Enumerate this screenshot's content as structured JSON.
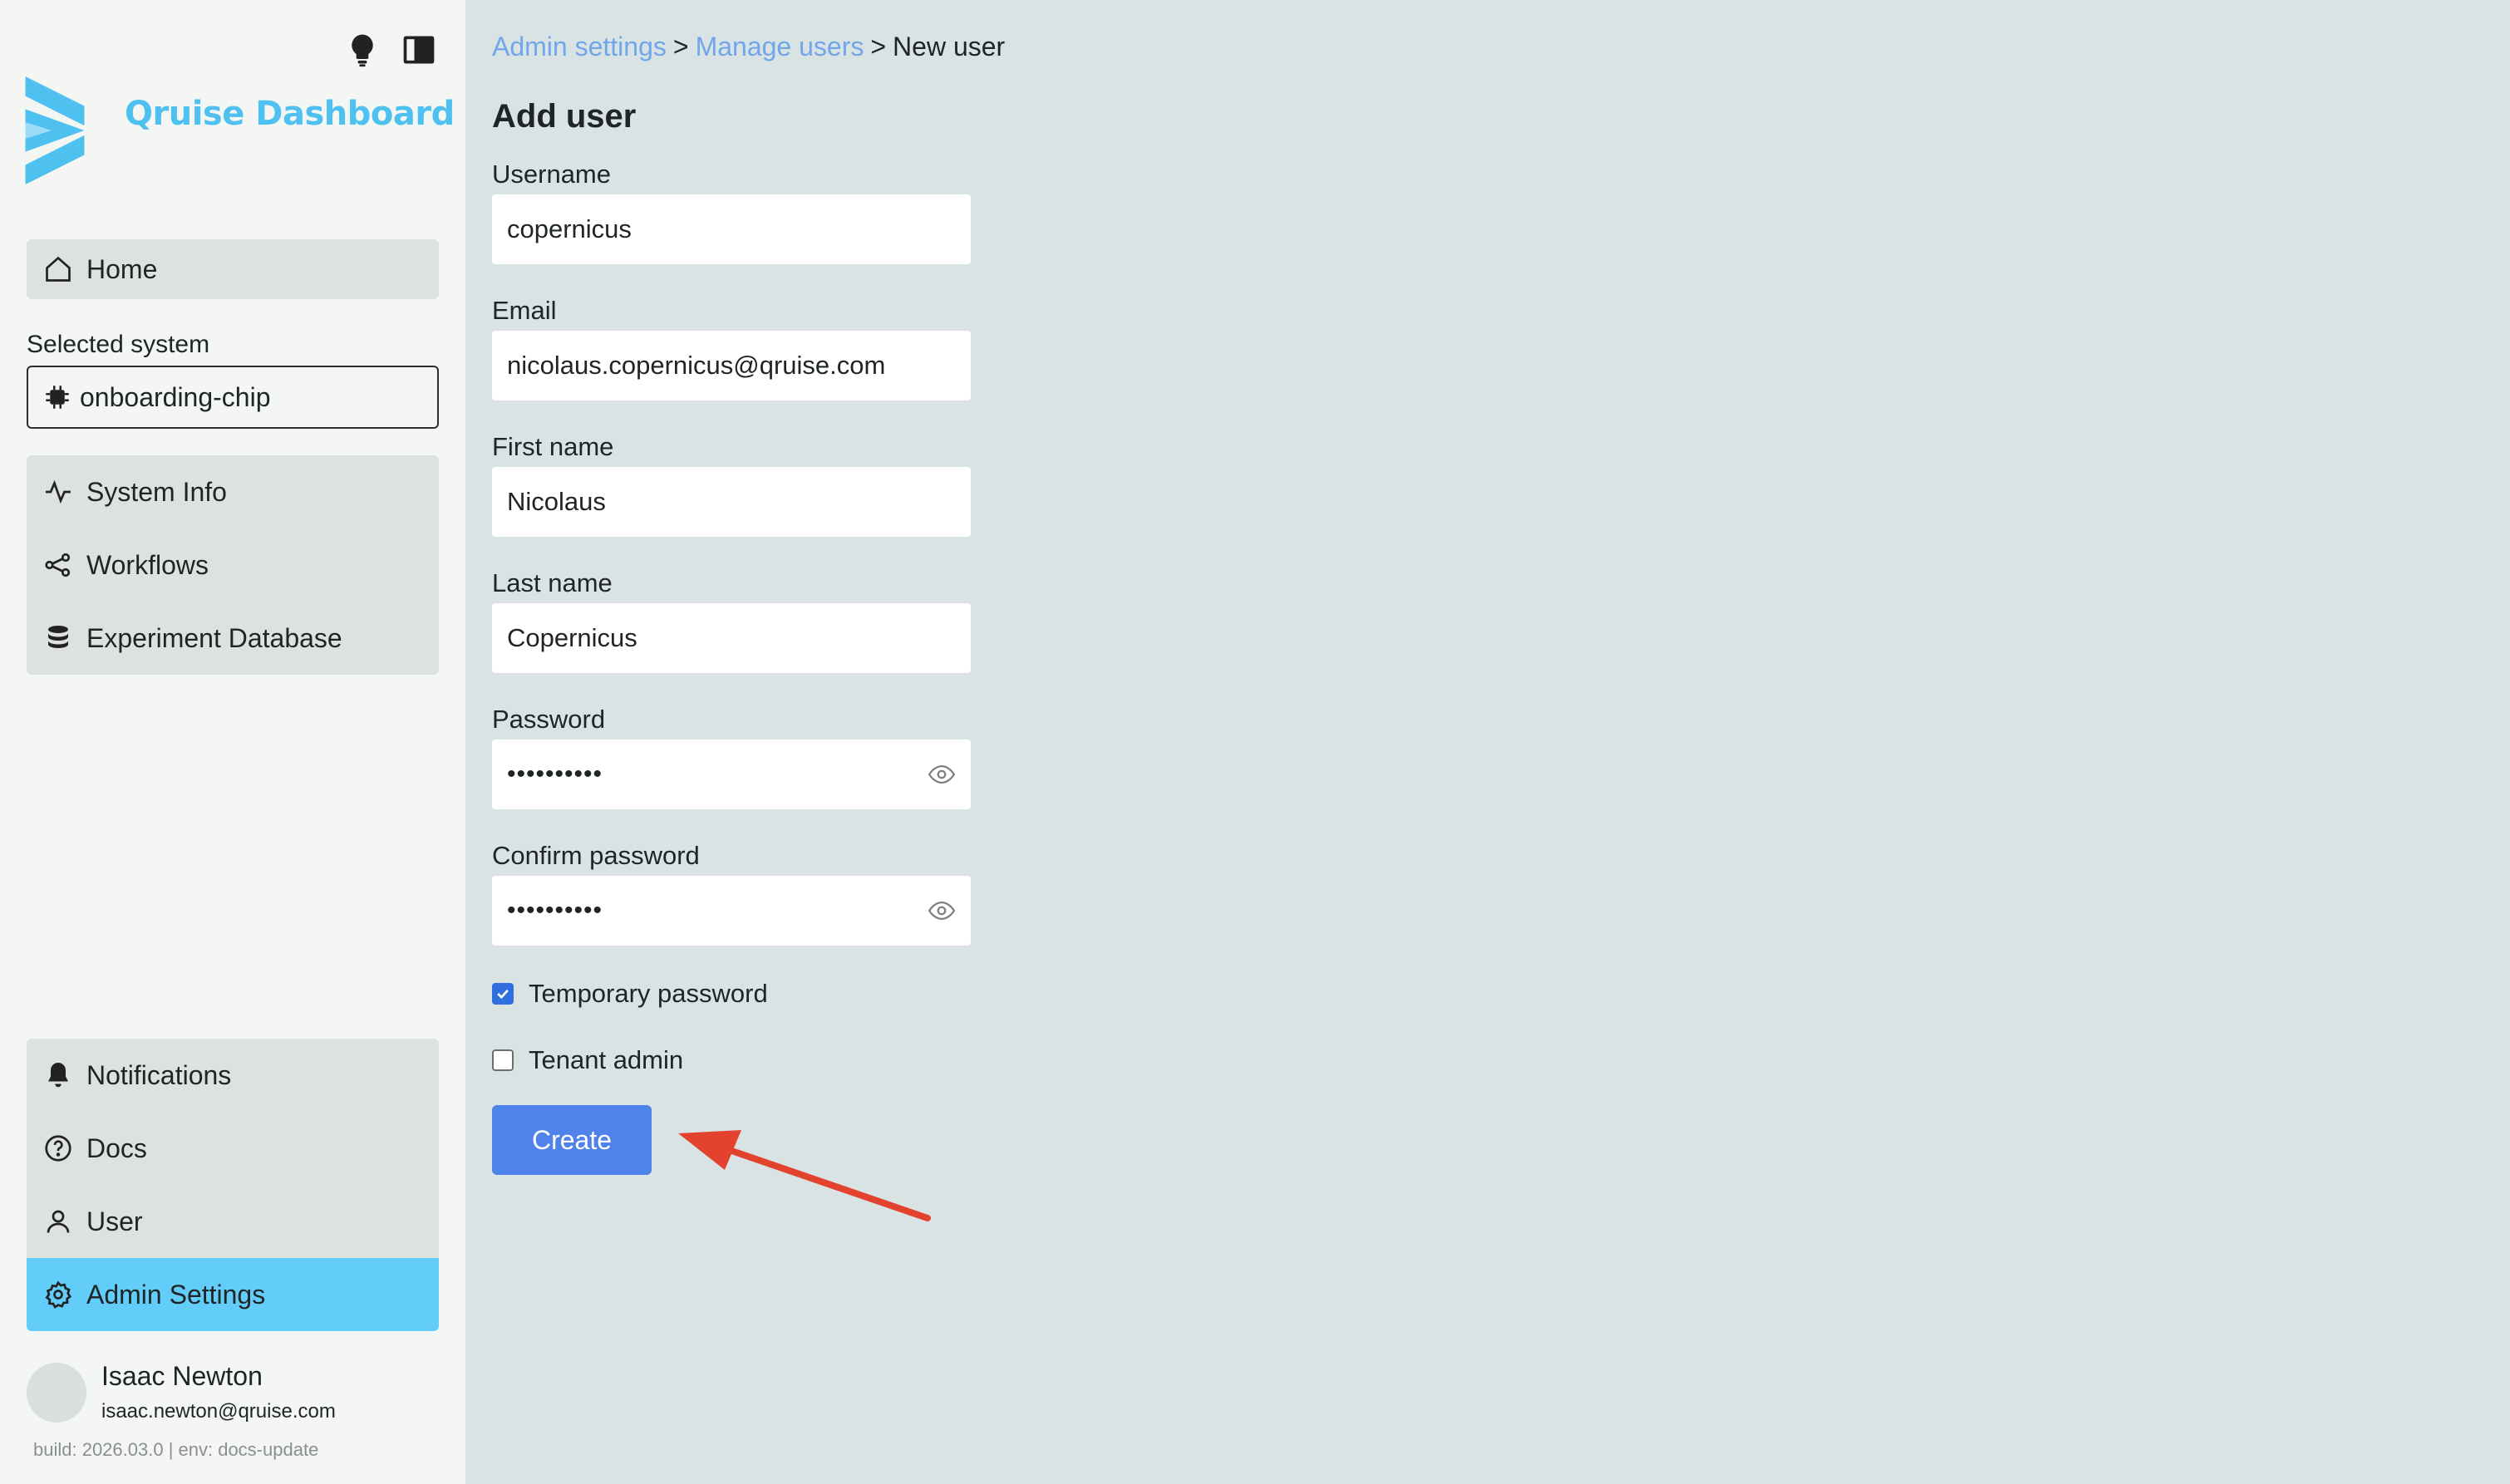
{
  "app": {
    "name": "Qruise Dashboard",
    "accent": "#4fc1f0",
    "active_nav": "#63cdfa"
  },
  "sidebar": {
    "top_icons": [
      "lightbulb-icon",
      "sidebar-toggle-icon"
    ],
    "home": {
      "label": "Home",
      "icon": "home-icon"
    },
    "selected_system": {
      "label": "Selected system",
      "value": "onboarding-chip",
      "icon": "chip-icon"
    },
    "system_nav": [
      {
        "label": "System Info",
        "icon": "activity-icon"
      },
      {
        "label": "Workflows",
        "icon": "workflow-icon"
      },
      {
        "label": "Experiment Database",
        "icon": "database-icon"
      }
    ],
    "bottom_nav": [
      {
        "label": "Notifications",
        "icon": "bell-icon"
      },
      {
        "label": "Docs",
        "icon": "help-circle-icon"
      },
      {
        "label": "User",
        "icon": "user-icon"
      },
      {
        "label": "Admin Settings",
        "icon": "gear-icon",
        "active": true
      }
    ],
    "user": {
      "name": "Isaac Newton",
      "email": "isaac.newton@qruise.com"
    },
    "build": "build: 2026.03.0 | env: docs-update"
  },
  "breadcrumb": {
    "items": [
      "Admin settings",
      "Manage users",
      "New user"
    ],
    "separator": ">"
  },
  "form": {
    "title": "Add user",
    "fields": [
      {
        "label": "Username",
        "value": "copernicus"
      },
      {
        "label": "Email",
        "value": "nicolaus.copernicus@qruise.com"
      },
      {
        "label": "First name",
        "value": "Nicolaus"
      },
      {
        "label": "Last name",
        "value": "Copernicus"
      },
      {
        "label": "Password",
        "value": "••••••••••",
        "type": "password"
      },
      {
        "label": "Confirm password",
        "value": "••••••••••",
        "type": "password"
      }
    ],
    "checkboxes": [
      {
        "label": "Temporary password",
        "checked": true
      },
      {
        "label": "Tenant admin",
        "checked": false
      }
    ],
    "submit_label": "Create",
    "annotation": {
      "type": "arrow",
      "color": "#e3432e",
      "points_to": "Create"
    }
  }
}
